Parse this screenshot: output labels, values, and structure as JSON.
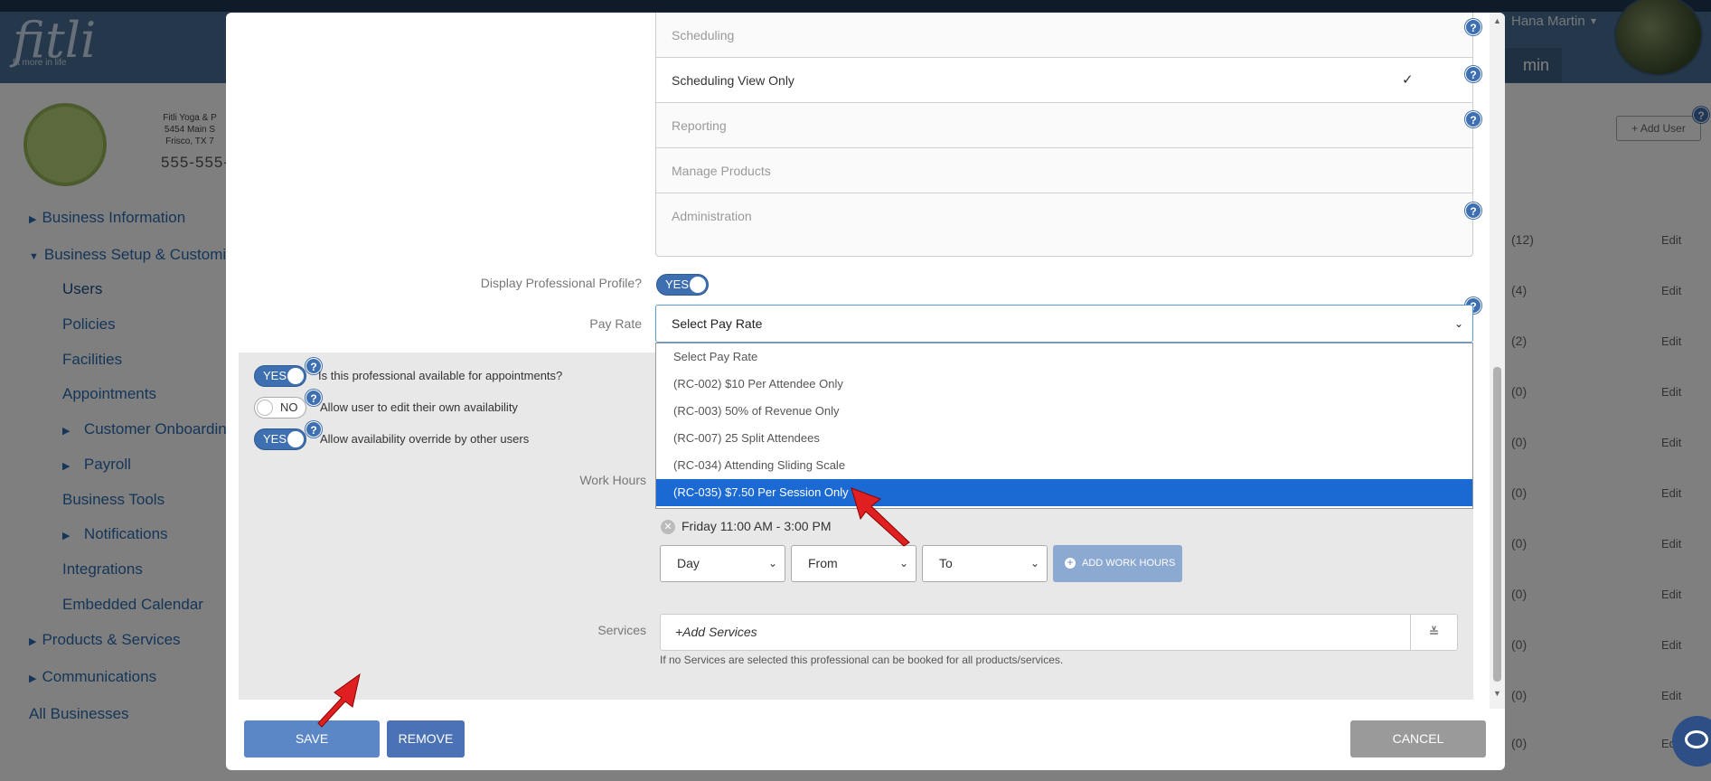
{
  "header": {
    "logo": "fitli",
    "logo_tagline": "fit more in life",
    "user_name": "Hana Martin",
    "admin_label": "min"
  },
  "business": {
    "name_line": "Fitli Yoga & P",
    "address_line1": "5454 Main S",
    "address_line2": "Frisco, TX 7",
    "phone": "555-555-"
  },
  "sidebar": {
    "items": [
      {
        "label": "Business Information"
      },
      {
        "label": "Business Setup & Customiza"
      },
      {
        "label": "Users"
      },
      {
        "label": "Policies"
      },
      {
        "label": "Facilities"
      },
      {
        "label": "Appointments"
      },
      {
        "label": "Customer Onboarding"
      },
      {
        "label": "Payroll"
      },
      {
        "label": "Business Tools"
      },
      {
        "label": "Notifications"
      },
      {
        "label": "Integrations"
      },
      {
        "label": "Embedded Calendar"
      },
      {
        "label": "Products & Services"
      },
      {
        "label": "Communications"
      },
      {
        "label": "All Businesses"
      }
    ]
  },
  "user_table": {
    "add_user_label": "+ Add User",
    "counts": [
      "(12)",
      "(4)",
      "(2)",
      "(0)",
      "(0)",
      "(0)",
      "(0)",
      "(0)",
      "(0)",
      "(0)",
      "(0)"
    ],
    "edit_label": "Edit"
  },
  "permissions": {
    "rows": [
      {
        "label": "Scheduling",
        "checked": false
      },
      {
        "label": "Scheduling View Only",
        "checked": true
      },
      {
        "label": "Reporting",
        "checked": false
      },
      {
        "label": "Manage Products",
        "checked": false
      },
      {
        "label": "Administration",
        "checked": false
      }
    ],
    "check_glyph": "✓"
  },
  "professional_profile": {
    "label": "Display Professional Profile?",
    "toggle": "YES"
  },
  "pay_rate": {
    "label": "Pay Rate",
    "selected": "Select Pay Rate",
    "options": [
      "Select Pay Rate",
      "(RC-002) $10 Per Attendee Only",
      "(RC-003) 50% of Revenue Only",
      "(RC-007) 25 Split Attendees",
      "(RC-034) Attending Sliding Scale",
      "(RC-035) $7.50 Per Session Only"
    ],
    "highlighted_index": 5
  },
  "availability": {
    "appointments": {
      "toggle": "YES",
      "label": "Is this professional available for appointments?"
    },
    "edit_own": {
      "toggle": "NO",
      "label": "Allow user to edit their own availability"
    },
    "override": {
      "toggle": "YES",
      "label": "Allow availability override by other users"
    }
  },
  "work_hours": {
    "label": "Work Hours",
    "entries": [
      "Friday 11:00 AM - 3:00 PM"
    ],
    "day_placeholder": "Day",
    "from_placeholder": "From",
    "to_placeholder": "To",
    "add_label": "ADD WORK HOURS"
  },
  "services": {
    "label": "Services",
    "add_label": "+Add Services",
    "toggle_glyph": "≚",
    "help": "If no Services are selected this professional can be booked for all products/services."
  },
  "footer": {
    "save": "SAVE",
    "remove": "REMOVE",
    "cancel": "CANCEL"
  },
  "colors": {
    "primary": "#3e6fb0",
    "highlight": "#1b6ad4",
    "save": "#5b87c7",
    "cancel": "#9a9a9a",
    "arrow": "#e02020"
  },
  "help_glyph": "?"
}
